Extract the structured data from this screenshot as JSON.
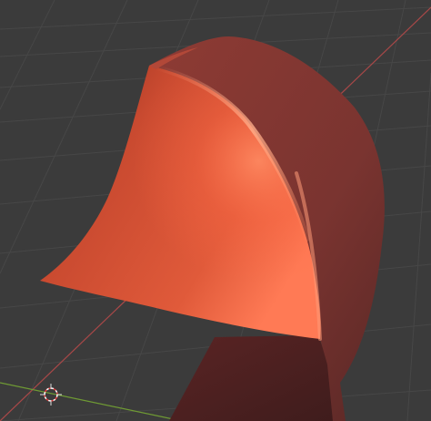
{
  "viewport": {
    "kind": "3D viewport",
    "shading": "solid",
    "background_color": "#3b3b3b",
    "grid_color": "#4a4a4a",
    "x_axis_color": "#b24a4a",
    "y_axis_color": "#7ca33a",
    "object_color": "#d4583e",
    "cursor_icon": "3d-cursor-icon"
  }
}
